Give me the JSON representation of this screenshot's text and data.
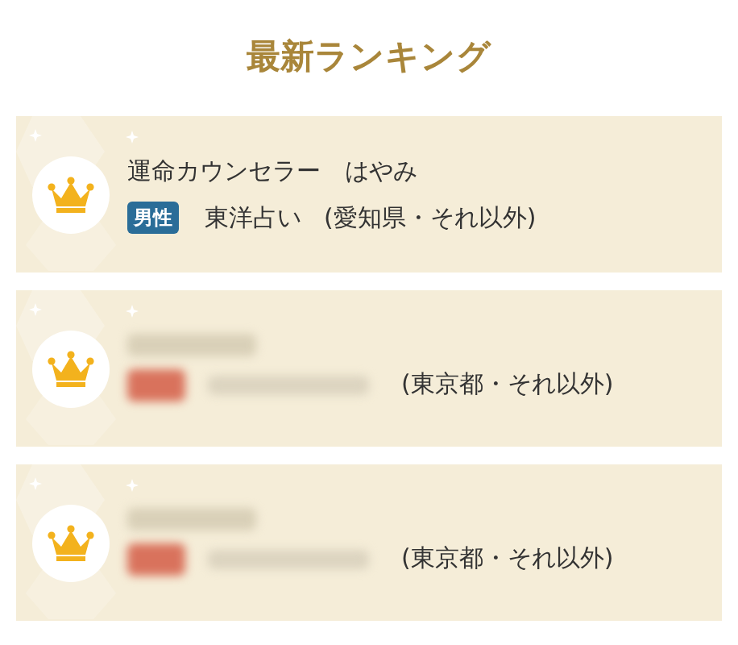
{
  "title": "最新ランキング",
  "rankings": [
    {
      "blurred": false,
      "name": "運命カウンセラー　はやみ",
      "badge": {
        "label": "男性",
        "color": "#2a6d98"
      },
      "category": "東洋占い",
      "location": "(愛知県・それ以外)"
    },
    {
      "blurred": true,
      "badge": {
        "color": "#d9725c"
      },
      "location": "(東京都・それ以外)"
    },
    {
      "blurred": true,
      "badge": {
        "color": "#d9725c"
      },
      "location": "(東京都・それ以外)"
    }
  ]
}
